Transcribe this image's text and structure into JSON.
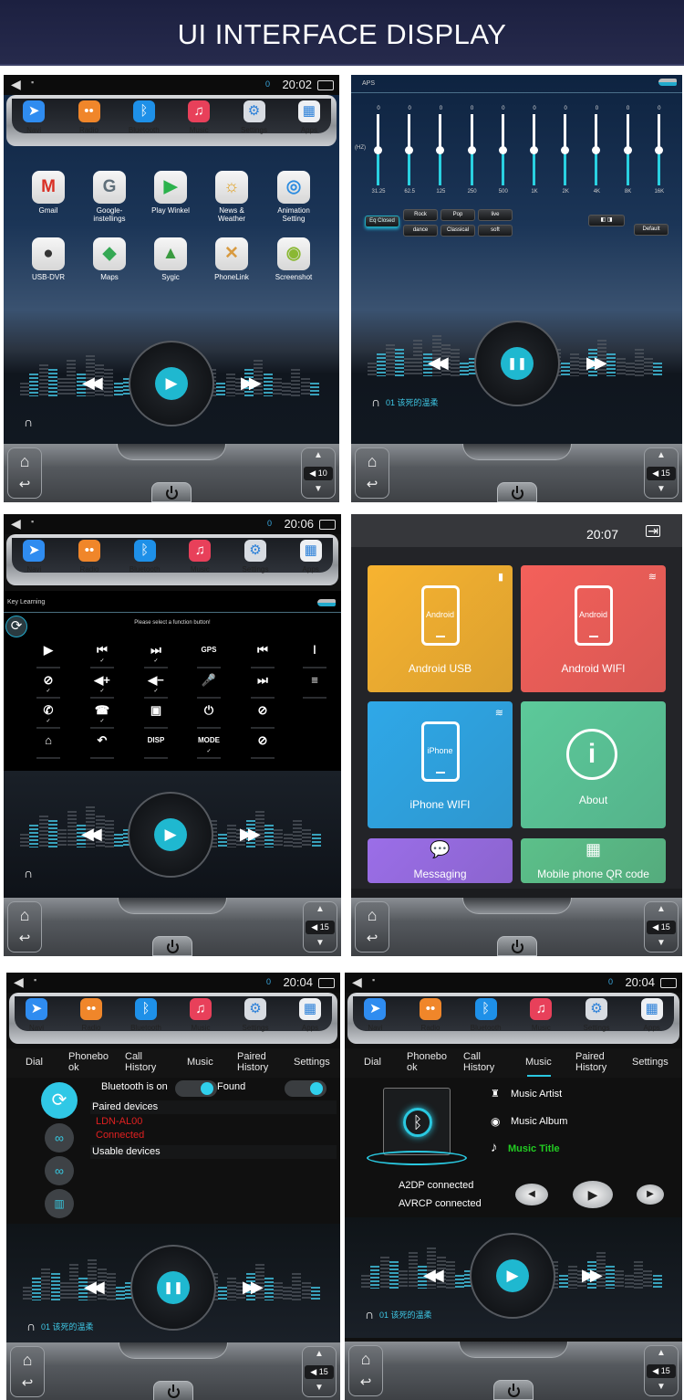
{
  "header": {
    "title": "UI INTERFACE DISPLAY"
  },
  "dock": {
    "items": [
      {
        "label": "Navi",
        "icon": "navi-icon",
        "glyph": "➤",
        "color": "#2f8cf0"
      },
      {
        "label": "Radio",
        "icon": "radio-icon",
        "glyph": "••",
        "color": "#f0862a"
      },
      {
        "label": "Bluetooth",
        "icon": "bluetooth-icon",
        "glyph": "ᛒ",
        "color": "#1e90e8"
      },
      {
        "label": "Music",
        "icon": "music-icon",
        "glyph": "♫",
        "color": "#e8405a"
      },
      {
        "label": "Settings",
        "icon": "settings-icon",
        "glyph": "⚙",
        "color": "#d8dce2"
      },
      {
        "label": "Apps",
        "icon": "apps-icon",
        "glyph": "▦",
        "color": "#eef0f3"
      }
    ]
  },
  "panels": {
    "home": {
      "status": {
        "counter": "0",
        "time": "20:02"
      },
      "apps": [
        {
          "label": "Gmail",
          "icon": "gmail-icon",
          "glyph": "M",
          "color": "#d93025"
        },
        {
          "label": "Google-\ninstellings",
          "icon": "google-settings-icon",
          "glyph": "G",
          "color": "#5f6f7a"
        },
        {
          "label": "Play Winkel",
          "icon": "play-store-icon",
          "glyph": "▶",
          "color": "#2bb24c"
        },
        {
          "label": "News &\nWeather",
          "icon": "news-weather-icon",
          "glyph": "☼",
          "color": "#e0a020"
        },
        {
          "label": "Animation\nSetting",
          "icon": "animation-setting-icon",
          "glyph": "◎",
          "color": "#2c8ce0"
        },
        {
          "label": "USB-DVR",
          "icon": "usb-dvr-icon",
          "glyph": "●",
          "color": "#333333"
        },
        {
          "label": "Maps",
          "icon": "maps-icon",
          "glyph": "◆",
          "color": "#34a853"
        },
        {
          "label": "Sygic",
          "icon": "sygic-icon",
          "glyph": "▲",
          "color": "#3a9a40"
        },
        {
          "label": "PhoneLink",
          "icon": "phonelink-icon",
          "glyph": "✕",
          "color": "#d89a40"
        },
        {
          "label": "Screenshot",
          "icon": "screenshot-icon",
          "glyph": "◉",
          "color": "#8ab833"
        }
      ],
      "volume": "10"
    },
    "eq": {
      "title": "APS",
      "unit": "(HZ)",
      "bands": [
        {
          "freq": "31.25",
          "value": "0"
        },
        {
          "freq": "62.5",
          "value": "0"
        },
        {
          "freq": "125",
          "value": "0"
        },
        {
          "freq": "250",
          "value": "0"
        },
        {
          "freq": "500",
          "value": "0"
        },
        {
          "freq": "1K",
          "value": "0"
        },
        {
          "freq": "2K",
          "value": "0"
        },
        {
          "freq": "4K",
          "value": "0"
        },
        {
          "freq": "8K",
          "value": "0"
        },
        {
          "freq": "16K",
          "value": "0"
        }
      ],
      "eq_closed": "Eq Closed",
      "presets": [
        "Rock",
        "Pop",
        "live",
        "dance",
        "Classical",
        "soft"
      ],
      "default": "Default",
      "song": "01 该死的温柔",
      "volume": "15"
    },
    "key_learning": {
      "status": {
        "counter": "0",
        "time": "20:06"
      },
      "title": "Key Learning",
      "prompt": "Please select a function button!",
      "keys": [
        {
          "icon": "play-icon",
          "glyph": "▶",
          "checked": false
        },
        {
          "icon": "previous-track-icon",
          "glyph": "⏮",
          "checked": true
        },
        {
          "icon": "next-track-icon",
          "glyph": "⏭",
          "checked": true
        },
        {
          "icon": "gps-icon",
          "glyph": "GPS",
          "checked": false
        },
        {
          "icon": "previous-call-icon",
          "glyph": "⏮",
          "checked": false
        },
        {
          "icon": "mic-jack-icon",
          "glyph": "ǀ",
          "checked": false
        },
        {
          "icon": "mute-icon",
          "glyph": "⊘",
          "checked": true
        },
        {
          "icon": "volume-up-icon",
          "glyph": "◀+",
          "checked": true
        },
        {
          "icon": "volume-down-icon",
          "glyph": "◀−",
          "checked": true
        },
        {
          "icon": "microphone-icon",
          "glyph": "🎤",
          "checked": false
        },
        {
          "icon": "next-hangup-icon",
          "glyph": "⏭",
          "checked": false
        },
        {
          "icon": "partial-icon",
          "glyph": "≡",
          "checked": false
        },
        {
          "icon": "call-icon",
          "glyph": "✆",
          "checked": true
        },
        {
          "icon": "hangup-icon",
          "glyph": "☎",
          "checked": true
        },
        {
          "icon": "radio-icon",
          "glyph": "▣",
          "checked": false
        },
        {
          "icon": "power-icon",
          "glyph": "⏻",
          "checked": false
        },
        {
          "icon": "mute-hangup-icon",
          "glyph": "⊘",
          "checked": false
        },
        {
          "icon": "home-icon",
          "glyph": "⌂",
          "checked": false
        },
        {
          "icon": "back-icon",
          "glyph": "↶",
          "checked": false
        },
        {
          "icon": "disp-icon",
          "glyph": "DISP",
          "checked": false
        },
        {
          "icon": "mode-icon",
          "glyph": "MODE",
          "checked": true
        },
        {
          "icon": "mute-call-icon",
          "glyph": "⊘",
          "checked": false
        }
      ],
      "check": "✓",
      "volume": "15"
    },
    "phonelink": {
      "time": "20:07",
      "tiles": [
        {
          "label": "Android USB",
          "phone_text": "Android",
          "color": "#f7b330"
        },
        {
          "label": "Android WIFI",
          "phone_text": "Android",
          "color": "#f4605a"
        },
        {
          "label": "iPhone WIFI",
          "phone_text": "iPhone",
          "color": "#2fa8e8"
        },
        {
          "label": "About",
          "color": "#5cc99a"
        },
        {
          "label": "Messaging",
          "color": "#9b6ee8"
        },
        {
          "label": "Mobile phone QR code",
          "color": "#5cc08a"
        }
      ],
      "volume": "15"
    },
    "bt_devices": {
      "status": {
        "counter": "0",
        "time": "20:04"
      },
      "tabs": [
        "Dial",
        "Phonebo\nok",
        "Call\nHistory",
        "Music",
        "Paired\nHistory",
        "Settings"
      ],
      "bluetooth_on": "Bluetooth is on",
      "bluetooth_on_state": true,
      "found": "Found",
      "found_state": true,
      "paired_header": "Paired devices",
      "device_name": "LDN-AL00",
      "device_status": "Connected",
      "usable_header": "Usable devices",
      "song": "01 该死的温柔",
      "volume": "15"
    },
    "bt_music": {
      "status": {
        "counter": "0",
        "time": "20:04"
      },
      "tabs": [
        "Dial",
        "Phonebo\nok",
        "Call\nHistory",
        "Music",
        "Paired\nHistory",
        "Settings"
      ],
      "active_tab": "Music",
      "artist": "Music Artist",
      "album": "Music Album",
      "title": "Music Title",
      "a2dp": "A2DP connected",
      "avrcp": "AVRCP connected",
      "song": "01 该死的温柔",
      "volume": "15"
    }
  },
  "colors": {
    "accent": "#1fb8d0",
    "connected": "#e02020",
    "music_title": "#22cc22",
    "banner": "#1f2344"
  }
}
